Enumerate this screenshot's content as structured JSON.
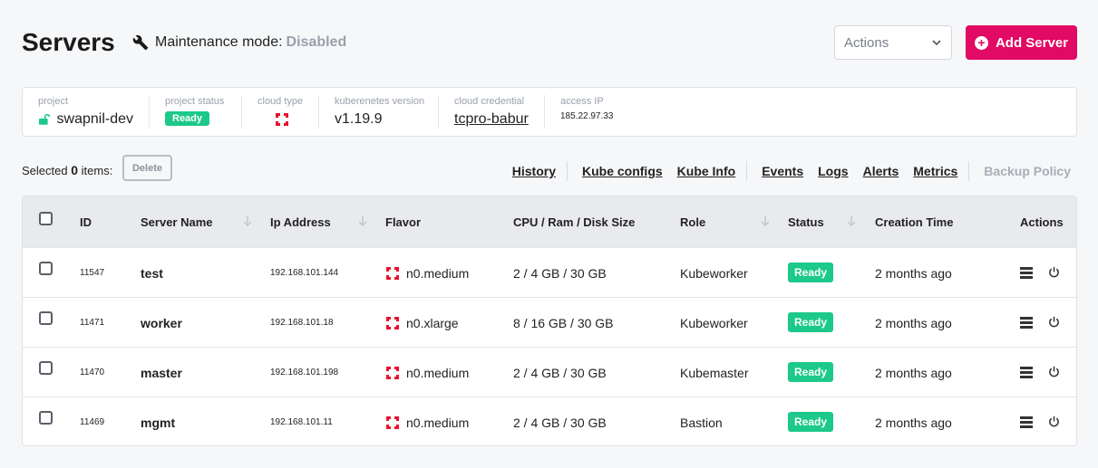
{
  "header": {
    "title": "Servers",
    "maintenance_label": "Maintenance mode:",
    "maintenance_status": "Disabled",
    "actions_placeholder": "Actions",
    "add_server_label": "Add Server"
  },
  "info": {
    "project_label": "project",
    "project_value": "swapnil-dev",
    "project_status_label": "project status",
    "project_status_value": "Ready",
    "cloud_type_label": "cloud type",
    "k8s_label": "kuberenetes version",
    "k8s_value": "v1.19.9",
    "credential_label": "cloud credential",
    "credential_value": "tcpro-babur",
    "access_ip_label": "access IP",
    "access_ip_value": "185.22.97.33"
  },
  "toolbar": {
    "selected_prefix": "Selected",
    "selected_count": "0",
    "selected_suffix": "items:",
    "delete_label": "Delete",
    "links": [
      "History",
      "Kube configs",
      "Kube Info",
      "Events",
      "Logs",
      "Alerts",
      "Metrics"
    ],
    "backup_policy": "Backup Policy"
  },
  "table": {
    "headers": {
      "id": "ID",
      "name": "Server Name",
      "ip": "Ip Address",
      "flavor": "Flavor",
      "cpu": "CPU / Ram / Disk Size",
      "role": "Role",
      "status": "Status",
      "created": "Creation Time",
      "actions": "Actions"
    },
    "rows": [
      {
        "id": "11547",
        "name": "test",
        "ip": "192.168.101.144",
        "flavor": "n0.medium",
        "cpu": "2 / 4 GB / 30 GB",
        "role": "Kubeworker",
        "status": "Ready",
        "created": "2 months ago"
      },
      {
        "id": "11471",
        "name": "worker",
        "ip": "192.168.101.18",
        "flavor": "n0.xlarge",
        "cpu": "8 / 16 GB / 30 GB",
        "role": "Kubeworker",
        "status": "Ready",
        "created": "2 months ago"
      },
      {
        "id": "11470",
        "name": "master",
        "ip": "192.168.101.198",
        "flavor": "n0.medium",
        "cpu": "2 / 4 GB / 30 GB",
        "role": "Kubemaster",
        "status": "Ready",
        "created": "2 months ago"
      },
      {
        "id": "11469",
        "name": "mgmt",
        "ip": "192.168.101.11",
        "flavor": "n0.medium",
        "cpu": "2 / 4 GB / 30 GB",
        "role": "Bastion",
        "status": "Ready",
        "created": "2 months ago"
      }
    ]
  },
  "colors": {
    "accent": "#e10a64",
    "ready": "#1cc98a",
    "cloud_logo": "#e8112d"
  }
}
